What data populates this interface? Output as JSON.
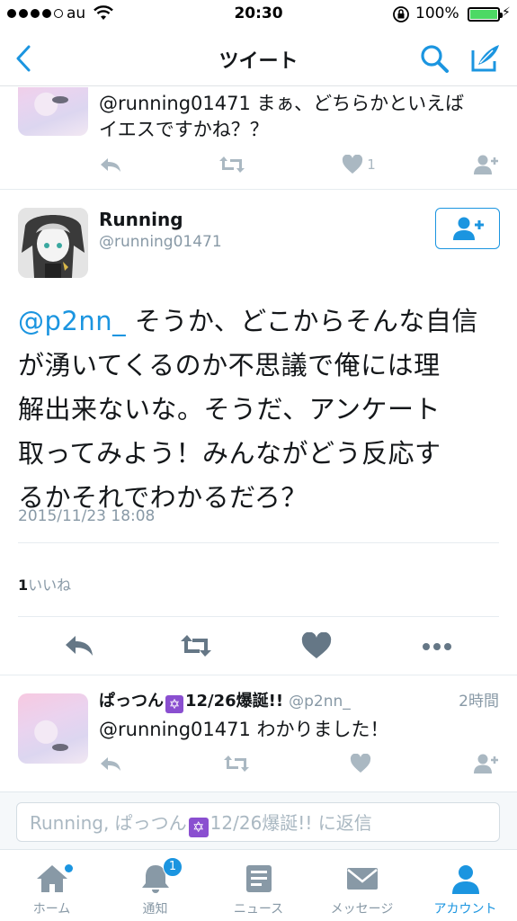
{
  "status_bar": {
    "carrier": "au",
    "time": "20:30",
    "battery_percent": "100%"
  },
  "nav": {
    "title": "ツイート"
  },
  "reply_top": {
    "text_line1": "@running01471 まぁ、どちらかといえば",
    "text_line2": "イエスですかね？？",
    "like_count": "1"
  },
  "main_tweet": {
    "display_name": "Running",
    "handle": "@running01471",
    "mention": "@p2nn_",
    "body_line1_rest": " そうか、どこからそんな自信",
    "body_line2": "が湧いてくるのか不思議で俺には理",
    "body_line3": "解出来ないな。そうだ、アンケート",
    "body_line4": "取ってみよう！みんながどう反応す",
    "body_line5": "るかそれでわかるだろ？",
    "timestamp": "2015/11/23 18:08",
    "likes_count": "1",
    "likes_label": "いいね"
  },
  "reply_bottom": {
    "name_prefix": "ぱっつん",
    "name_suffix": "12/26爆誕!!",
    "handle": "@p2nn_",
    "time": "2時間",
    "text": "@running01471 わかりました！"
  },
  "composer": {
    "placeholder_prefix": "Running, ぱっつん",
    "placeholder_suffix": "12/26爆誕!! に返信"
  },
  "tabs": [
    {
      "label": "ホーム",
      "icon": "home-icon"
    },
    {
      "label": "通知",
      "icon": "bell-icon",
      "badge": "1"
    },
    {
      "label": "ニュース",
      "icon": "news-icon"
    },
    {
      "label": "メッセージ",
      "icon": "envelope-icon"
    },
    {
      "label": "アカウント",
      "icon": "person-icon"
    }
  ],
  "colors": {
    "accent": "#1b95e0",
    "muted": "#8899a6",
    "icon_muted": "#aab8c2"
  }
}
